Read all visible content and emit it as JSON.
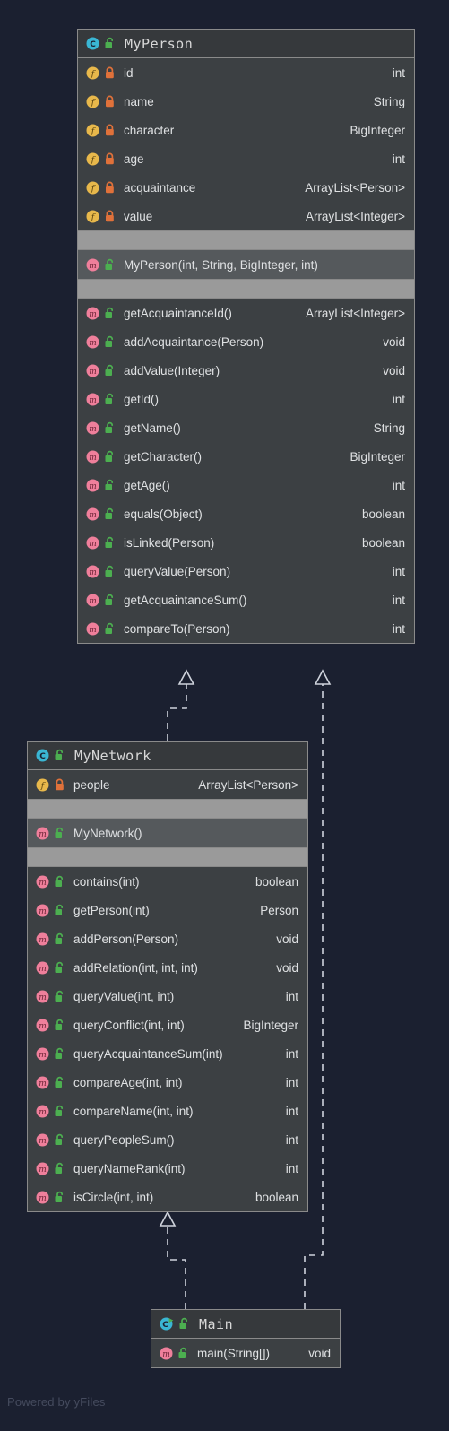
{
  "diagram": {
    "kind": "uml-class-diagram",
    "background_color": "#1b2030",
    "watermark": "Powered by yFiles",
    "box_fill": "#3c4043",
    "header_fill": "#36393c",
    "band_fill": "#9a9a9a",
    "ctor_row_fill": "#55595c",
    "border_color": "#8a8a8a",
    "text_color": "#dfe1e3",
    "edge_color": "#cfd3dc"
  },
  "icons": {
    "class": "class-icon",
    "class_runnable": "class-runnable-icon",
    "field": "field-icon",
    "method": "method-icon",
    "lock_private": "lock-closed-icon",
    "lock_public": "lock-open-icon",
    "inheritance_arrow": "hollow-arrowhead-icon"
  },
  "icon_colors": {
    "class_circle": "#3ab6d4",
    "class_letter": "#1b2030",
    "field_circle": "#e8b84b",
    "field_letter": "#5a4410",
    "method_circle": "#ef7f9b",
    "method_letter": "#6d2336",
    "lock_closed": "#e0713a",
    "lock_open": "#4caf50",
    "runnable_arrow": "#4caf50"
  },
  "classes": [
    {
      "id": "MyPerson",
      "name": "MyPerson",
      "icon": "class-icon",
      "visibility_icon": "lock-open-icon",
      "fields": [
        {
          "icon": "field-icon",
          "visibility_icon": "lock-closed-icon",
          "name": "id",
          "type": "int"
        },
        {
          "icon": "field-icon",
          "visibility_icon": "lock-closed-icon",
          "name": "name",
          "type": "String"
        },
        {
          "icon": "field-icon",
          "visibility_icon": "lock-closed-icon",
          "name": "character",
          "type": "BigInteger"
        },
        {
          "icon": "field-icon",
          "visibility_icon": "lock-closed-icon",
          "name": "age",
          "type": "int"
        },
        {
          "icon": "field-icon",
          "visibility_icon": "lock-closed-icon",
          "name": "acquaintance",
          "type": "ArrayList<Person>"
        },
        {
          "icon": "field-icon",
          "visibility_icon": "lock-closed-icon",
          "name": "value",
          "type": "ArrayList<Integer>"
        }
      ],
      "constructors": [
        {
          "icon": "method-icon",
          "visibility_icon": "lock-open-icon",
          "name": "MyPerson(int, String, BigInteger, int)",
          "type": ""
        }
      ],
      "methods": [
        {
          "icon": "method-icon",
          "visibility_icon": "lock-open-icon",
          "name": "getAcquaintanceId()",
          "type": "ArrayList<Integer>"
        },
        {
          "icon": "method-icon",
          "visibility_icon": "lock-open-icon",
          "name": "addAcquaintance(Person)",
          "type": "void"
        },
        {
          "icon": "method-icon",
          "visibility_icon": "lock-open-icon",
          "name": "addValue(Integer)",
          "type": "void"
        },
        {
          "icon": "method-icon",
          "visibility_icon": "lock-open-icon",
          "name": "getId()",
          "type": "int"
        },
        {
          "icon": "method-icon",
          "visibility_icon": "lock-open-icon",
          "name": "getName()",
          "type": "String"
        },
        {
          "icon": "method-icon",
          "visibility_icon": "lock-open-icon",
          "name": "getCharacter()",
          "type": "BigInteger"
        },
        {
          "icon": "method-icon",
          "visibility_icon": "lock-open-icon",
          "name": "getAge()",
          "type": "int"
        },
        {
          "icon": "method-icon",
          "visibility_icon": "lock-open-icon",
          "name": "equals(Object)",
          "type": "boolean"
        },
        {
          "icon": "method-icon",
          "visibility_icon": "lock-open-icon",
          "name": "isLinked(Person)",
          "type": "boolean"
        },
        {
          "icon": "method-icon",
          "visibility_icon": "lock-open-icon",
          "name": "queryValue(Person)",
          "type": "int"
        },
        {
          "icon": "method-icon",
          "visibility_icon": "lock-open-icon",
          "name": "getAcquaintanceSum()",
          "type": "int"
        },
        {
          "icon": "method-icon",
          "visibility_icon": "lock-open-icon",
          "name": "compareTo(Person)",
          "type": "int"
        }
      ]
    },
    {
      "id": "MyNetwork",
      "name": "MyNetwork",
      "icon": "class-icon",
      "visibility_icon": "lock-open-icon",
      "fields": [
        {
          "icon": "field-icon",
          "visibility_icon": "lock-closed-icon",
          "name": "people",
          "type": "ArrayList<Person>"
        }
      ],
      "constructors": [
        {
          "icon": "method-icon",
          "visibility_icon": "lock-open-icon",
          "name": "MyNetwork()",
          "type": ""
        }
      ],
      "methods": [
        {
          "icon": "method-icon",
          "visibility_icon": "lock-open-icon",
          "name": "contains(int)",
          "type": "boolean"
        },
        {
          "icon": "method-icon",
          "visibility_icon": "lock-open-icon",
          "name": "getPerson(int)",
          "type": "Person"
        },
        {
          "icon": "method-icon",
          "visibility_icon": "lock-open-icon",
          "name": "addPerson(Person)",
          "type": "void"
        },
        {
          "icon": "method-icon",
          "visibility_icon": "lock-open-icon",
          "name": "addRelation(int, int, int)",
          "type": "void"
        },
        {
          "icon": "method-icon",
          "visibility_icon": "lock-open-icon",
          "name": "queryValue(int, int)",
          "type": "int"
        },
        {
          "icon": "method-icon",
          "visibility_icon": "lock-open-icon",
          "name": "queryConflict(int, int)",
          "type": "BigInteger"
        },
        {
          "icon": "method-icon",
          "visibility_icon": "lock-open-icon",
          "name": "queryAcquaintanceSum(int)",
          "type": "int"
        },
        {
          "icon": "method-icon",
          "visibility_icon": "lock-open-icon",
          "name": "compareAge(int, int)",
          "type": "int"
        },
        {
          "icon": "method-icon",
          "visibility_icon": "lock-open-icon",
          "name": "compareName(int, int)",
          "type": "int"
        },
        {
          "icon": "method-icon",
          "visibility_icon": "lock-open-icon",
          "name": "queryPeopleSum()",
          "type": "int"
        },
        {
          "icon": "method-icon",
          "visibility_icon": "lock-open-icon",
          "name": "queryNameRank(int)",
          "type": "int"
        },
        {
          "icon": "method-icon",
          "visibility_icon": "lock-open-icon",
          "name": "isCircle(int, int)",
          "type": "boolean"
        }
      ]
    },
    {
      "id": "Main",
      "name": "Main",
      "icon": "class-runnable-icon",
      "visibility_icon": "lock-open-icon",
      "fields": [],
      "constructors": [],
      "methods": [
        {
          "icon": "method-icon",
          "visibility_icon": "lock-open-icon",
          "name": "main(String[])",
          "type": "void"
        }
      ]
    }
  ],
  "edges": [
    {
      "from": "MyNetwork",
      "to": "MyPerson",
      "style": "dashed",
      "arrow": "hollow-triangle"
    },
    {
      "from": "Main",
      "to": "MyPerson",
      "style": "dashed",
      "arrow": "hollow-triangle"
    },
    {
      "from": "Main",
      "to": "MyNetwork",
      "style": "dashed",
      "arrow": "hollow-triangle"
    }
  ]
}
